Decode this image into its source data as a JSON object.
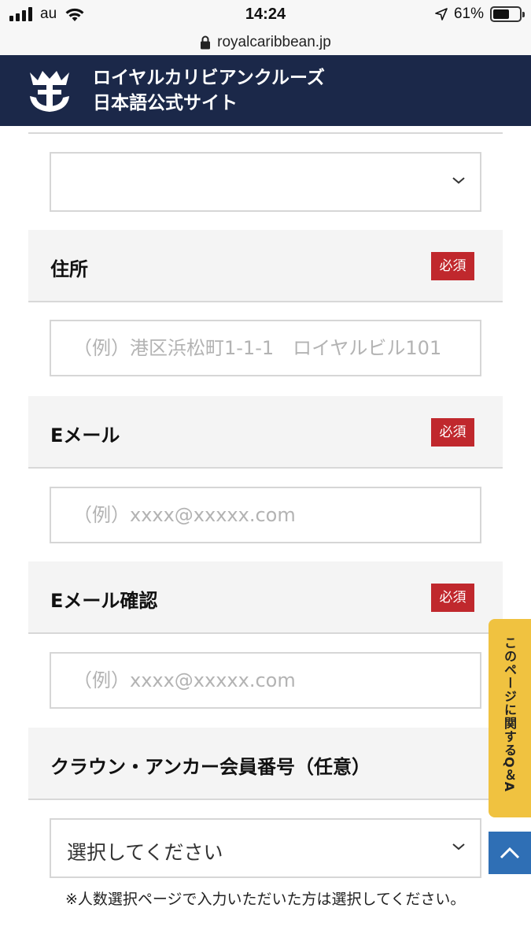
{
  "status_bar": {
    "carrier": "au",
    "time": "14:24",
    "battery_percent": "61%",
    "battery_level": 0.61
  },
  "browser": {
    "url": "royalcaribbean.jp"
  },
  "header": {
    "title_line1": "ロイヤルカリビアンクルーズ",
    "title_line2": "日本語公式サイト"
  },
  "form": {
    "top_select_value": "",
    "address": {
      "label": "住所",
      "required": "必須",
      "placeholder": "（例）港区浜松町1-1-1　ロイヤルビル101"
    },
    "email": {
      "label": "Eメール",
      "required": "必須",
      "placeholder": "（例）xxxx@xxxxx.com"
    },
    "email_confirm": {
      "label": "Eメール確認",
      "required": "必須",
      "placeholder": "（例）xxxx@xxxxx.com"
    },
    "crown_anchor": {
      "label": "クラウン・アンカー会員番号（任意）",
      "select_value": "選択してください"
    },
    "note": "※人数選択ページで入力いただいた方は選択してください。"
  },
  "side": {
    "qa_tab": "このページに関するQ＆A"
  },
  "colors": {
    "header_bg": "#1b2849",
    "required_badge": "#c0282d",
    "qa_tab": "#f0c240",
    "to_top": "#2f6fb5"
  },
  "icons": [
    "signal-icon",
    "wifi-icon",
    "location-arrow-icon",
    "battery-icon",
    "lock-icon",
    "crown-anchor-logo",
    "chevron-down-icon",
    "chevron-up-icon"
  ]
}
